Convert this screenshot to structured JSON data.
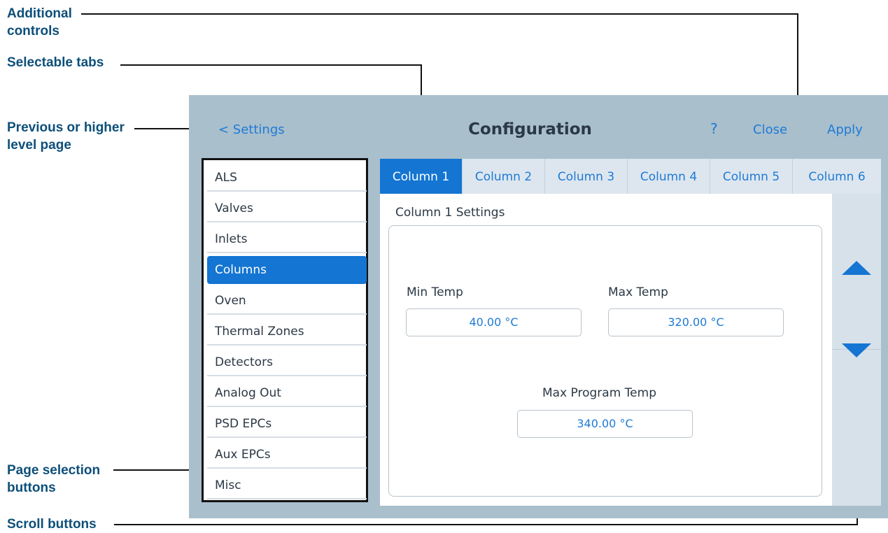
{
  "annotations": {
    "additional_controls": "Additional controls",
    "selectable_tabs": "Selectable tabs",
    "previous_page": "Previous or higher level page",
    "page_selection": "Page selection buttons",
    "scroll_buttons": "Scroll buttons"
  },
  "header": {
    "back_label": "< Settings",
    "title": "Configuration",
    "help_label": "?",
    "close_label": "Close",
    "apply_label": "Apply"
  },
  "sidebar": {
    "items": [
      {
        "label": "ALS"
      },
      {
        "label": "Valves"
      },
      {
        "label": "Inlets"
      },
      {
        "label": "Columns",
        "active": true
      },
      {
        "label": "Oven"
      },
      {
        "label": "Thermal Zones"
      },
      {
        "label": "Detectors"
      },
      {
        "label": "Analog Out"
      },
      {
        "label": "PSD EPCs"
      },
      {
        "label": "Aux EPCs"
      },
      {
        "label": "Misc"
      }
    ]
  },
  "tabs": [
    {
      "label": "Column 1",
      "active": true
    },
    {
      "label": "Column 2"
    },
    {
      "label": "Column 3"
    },
    {
      "label": "Column 4"
    },
    {
      "label": "Column 5"
    },
    {
      "label": "Column 6"
    }
  ],
  "content": {
    "section_title": "Column 1 Settings",
    "min_temp": {
      "label": "Min Temp",
      "value": "40.00 °C"
    },
    "max_temp": {
      "label": "Max Temp",
      "value": "320.00 °C"
    },
    "max_program_temp": {
      "label": "Max Program Temp",
      "value": "340.00 °C"
    }
  },
  "scroll": {
    "up_icon": "triangle-up-icon",
    "down_icon": "triangle-down-icon"
  },
  "colors": {
    "accent": "#1475d2",
    "link": "#1f7ad6",
    "screen_bg": "#a9bfcc",
    "annotation_text": "#0d4f7a"
  }
}
